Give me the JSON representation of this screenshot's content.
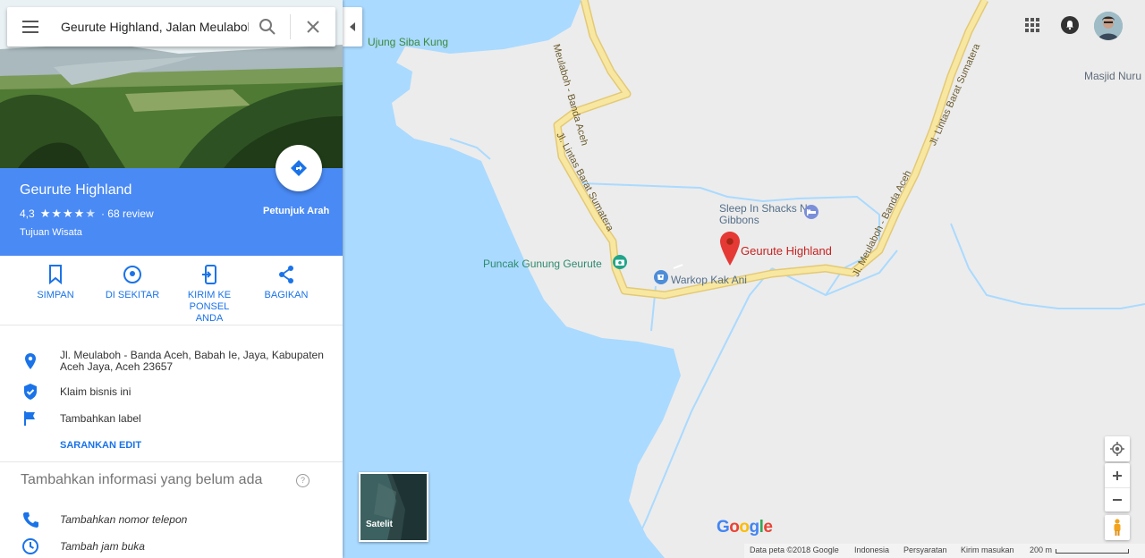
{
  "search": {
    "value": "Geurute Highland, Jalan Meulaboh - Banda Aceh"
  },
  "place": {
    "name": "Geurute Highland",
    "rating": "4,3",
    "stars": 4.3,
    "reviews": "· 68 review",
    "category": "Tujuan Wisata",
    "directions_label": "Petunjuk Arah"
  },
  "actions": [
    {
      "label": "SIMPAN",
      "icon": "bookmark-icon"
    },
    {
      "label": "DI SEKITAR",
      "icon": "nearby-icon"
    },
    {
      "label": "KIRIM KE PONSEL ANDA",
      "icon": "send-to-phone-icon"
    },
    {
      "label": "BAGIKAN",
      "icon": "share-icon"
    }
  ],
  "info": {
    "address": "Jl. Meulaboh - Banda Aceh, Babah Ie, Jaya, Kabupaten Aceh Jaya, Aceh 23657",
    "claim": "Klaim bisnis ini",
    "add_label": "Tambahkan label",
    "suggest_edit": "SARANKAN EDIT"
  },
  "missing_info": {
    "heading": "Tambahkan informasi yang belum ada",
    "phone": "Tambahkan nomor telepon",
    "hours": "Tambah jam buka"
  },
  "map_labels": {
    "water_label": "Ujung Siba Kung",
    "mosque": "Masjid Nuru",
    "road_banda": "Meulaboh - Banda Aceh",
    "road_lintas_left": "Jl. Lintas Barat Sumatera",
    "road_lintas_right": "Jl. Lintas Barat Sumatera",
    "road_meulaboh_right": "Jl. Meulaboh - Banda Aceh",
    "sleep": "Sleep In Shacks N Gibbons",
    "selected": "Geurute Highland",
    "puncak": "Puncak Gunung Geurute",
    "warkop": "Warkop Kak Ani"
  },
  "satellite_label": "Satelit",
  "google_logo": "Google",
  "attribution": {
    "data": "Data peta ©2018 Google",
    "country": "Indonesia",
    "terms": "Persyaratan",
    "feedback": "Kirim masukan",
    "scale": "200 m"
  },
  "colors": {
    "accent": "#4a8af4",
    "link": "#1a73e8",
    "water": "#aadaff",
    "land": "#ececec",
    "road": "#f8e7a0",
    "pin": "#e53935"
  }
}
